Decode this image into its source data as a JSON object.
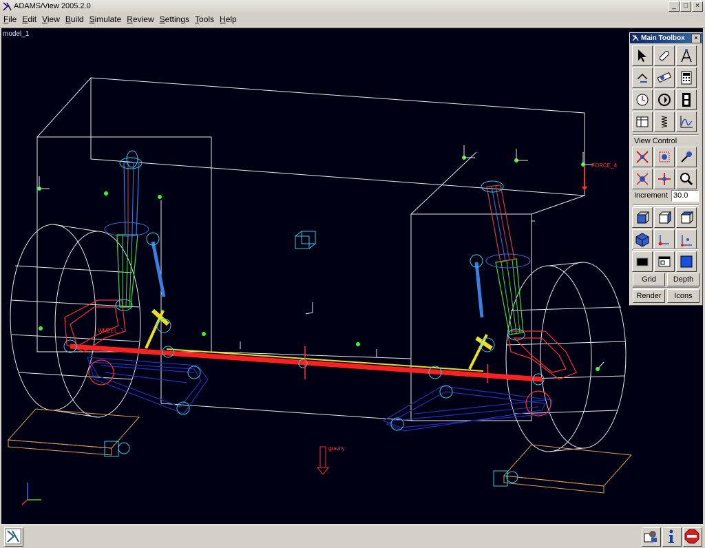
{
  "window": {
    "title": "ADAMS/View 2005.2.0",
    "buttons": [
      "_",
      "□",
      "×"
    ]
  },
  "menu": [
    {
      "label": "File"
    },
    {
      "label": "Edit"
    },
    {
      "label": "View"
    },
    {
      "label": "Build"
    },
    {
      "label": "Simulate"
    },
    {
      "label": "Review"
    },
    {
      "label": "Settings"
    },
    {
      "label": "Tools"
    },
    {
      "label": "Help"
    }
  ],
  "viewport": {
    "model_name": "model_1",
    "labels": {
      "force": "FORCE_4",
      "gravity": "gravity",
      "wheel_marker": "WHEEL_1"
    }
  },
  "toolbox": {
    "title": "Main Toolbox",
    "close": "×",
    "view_control_label": "View Control",
    "increment_label": "Increment",
    "increment_value": "30.0",
    "buttons": {
      "grid": "Grid",
      "depth": "Depth",
      "render": "Render",
      "icons": "Icons"
    },
    "tool_icons": [
      "select-arrow-icon",
      "link-icon",
      "compass-icon",
      "undo-measure-icon",
      "ruler-icon",
      "calculator-icon",
      "clock-icon",
      "simulate-icon",
      "filmstrip-icon",
      "table-editor-icon",
      "spring-icon",
      "plot-icon"
    ]
  },
  "colors": {
    "viewport_bg": "#000015",
    "wireframe": "#e8e8e8",
    "axle": "#ff2020",
    "shock_green": "#40e030",
    "shock_blue": "#3a7fe0",
    "control_arm": "#2030c0",
    "marker": "#30ff30",
    "spring_yellow": "#e8e020"
  }
}
